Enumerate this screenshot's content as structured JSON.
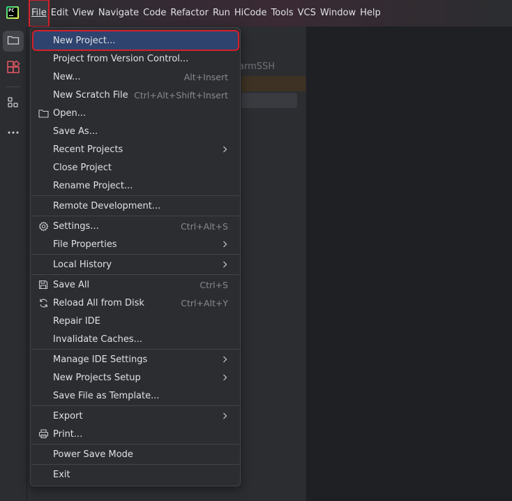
{
  "app": {
    "logo_text": "PC"
  },
  "menubar": {
    "items": [
      {
        "label": "File"
      },
      {
        "label": "Edit"
      },
      {
        "label": "View"
      },
      {
        "label": "Navigate"
      },
      {
        "label": "Code"
      },
      {
        "label": "Refactor"
      },
      {
        "label": "Run"
      },
      {
        "label": "HiCode"
      },
      {
        "label": "Tools"
      },
      {
        "label": "VCS"
      },
      {
        "label": "Window"
      },
      {
        "label": "Help"
      }
    ]
  },
  "sidebar": {
    "items": [
      {
        "icon": "folder-icon"
      },
      {
        "icon": "plugins-icon"
      },
      {
        "icon": "structure-icon"
      },
      {
        "icon": "more-icon"
      }
    ]
  },
  "background": {
    "partial_text": "armSSH"
  },
  "file_menu": {
    "items": [
      {
        "label": "New Project...",
        "selected": true
      },
      {
        "label": "Project from Version Control..."
      },
      {
        "label": "New...",
        "shortcut": "Alt+Insert"
      },
      {
        "label": "New Scratch File",
        "shortcut": "Ctrl+Alt+Shift+Insert"
      },
      {
        "label": "Open...",
        "icon": "folder-icon"
      },
      {
        "label": "Save As..."
      },
      {
        "label": "Recent Projects",
        "submenu": true
      },
      {
        "label": "Close Project"
      },
      {
        "label": "Rename Project..."
      },
      {
        "label": "Remote Development..."
      },
      {
        "label": "Settings...",
        "shortcut": "Ctrl+Alt+S",
        "icon": "gear-icon"
      },
      {
        "label": "File Properties",
        "submenu": true
      },
      {
        "label": "Local History",
        "submenu": true
      },
      {
        "label": "Save All",
        "shortcut": "Ctrl+S",
        "icon": "save-icon"
      },
      {
        "label": "Reload All from Disk",
        "shortcut": "Ctrl+Alt+Y",
        "icon": "reload-icon"
      },
      {
        "label": "Repair IDE"
      },
      {
        "label": "Invalidate Caches..."
      },
      {
        "label": "Manage IDE Settings",
        "submenu": true
      },
      {
        "label": "New Projects Setup",
        "submenu": true
      },
      {
        "label": "Save File as Template..."
      },
      {
        "label": "Export",
        "submenu": true
      },
      {
        "label": "Print...",
        "icon": "print-icon"
      },
      {
        "label": "Power Save Mode"
      },
      {
        "label": "Exit"
      }
    ]
  },
  "colors": {
    "selection": "#2e436e",
    "highlight_box": "#d6202a",
    "menu_bg": "#2b2d30",
    "text": "#dfe1e5",
    "shortcut_text": "#868a91"
  }
}
